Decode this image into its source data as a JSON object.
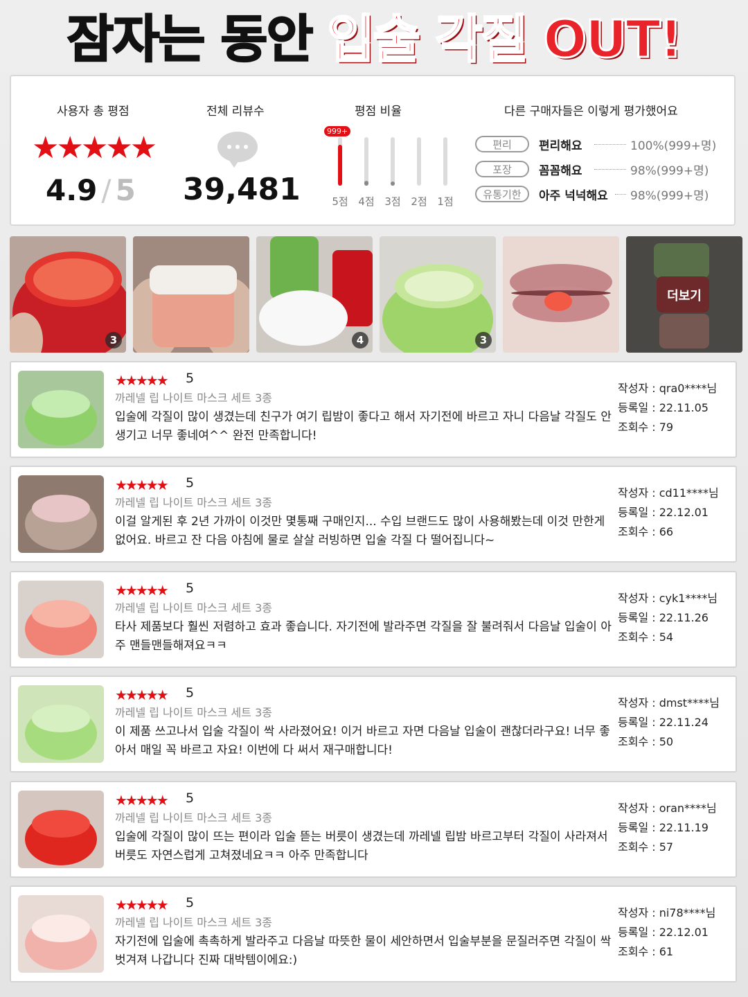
{
  "headline": {
    "part1": "잠자는 동안",
    "part2": "입술 각질 OUT!"
  },
  "summary": {
    "rating_title": "사용자 총 평점",
    "stars": "★★★★★",
    "rating": "4.9",
    "slash": "/",
    "rating_max": "5",
    "count_title": "전체 리뷰수",
    "review_count": "39,481",
    "ratio_title": "평점 비율",
    "ratio_badge": "999+",
    "ratio_bars": [
      {
        "label": "5점",
        "fill": 0.85,
        "color": "#e20f14"
      },
      {
        "label": "4점",
        "fill": 0.1,
        "color": "#888888"
      },
      {
        "label": "3점",
        "fill": 0.08,
        "color": "#888888"
      },
      {
        "label": "2점",
        "fill": 0.0,
        "color": "#888888"
      },
      {
        "label": "1점",
        "fill": 0.0,
        "color": "#888888"
      }
    ],
    "eval_title": "다른 구매자들은 이렇게 평가했어요",
    "evals": [
      {
        "pill": "편리",
        "text": "편리해요",
        "pct": "100%(999+명)"
      },
      {
        "pill": "포장",
        "text": "꼼꼼해요",
        "pct": "98%(999+명)"
      },
      {
        "pill": "유통기한",
        "text": "아주 넉넉해요",
        "pct": "98%(999+명)"
      }
    ]
  },
  "photos": {
    "counts": [
      "3",
      "4",
      "3"
    ],
    "more_label": "더보기"
  },
  "reviews": [
    {
      "stars": "★★★★★",
      "score": "5",
      "product": "까레넬 립 나이트 마스크 세트 3종",
      "text": "입술에 각질이 많이 생겼는데 친구가 여기 립밤이 좋다고 해서 자기전에 바르고 자니 다음날 각질도 안생기고 너무 좋네여^^ 완전 만족합니다!",
      "author": "작성자 : qra0****님",
      "date": "등록일 : 22.11.05",
      "views": "조회수 : 79"
    },
    {
      "stars": "★★★★★",
      "score": "5",
      "product": "까레넬 립 나이트 마스크 세트 3종",
      "text": "이걸 알게된 후 2년 가까이 이것만 몇통째 구매인지... 수입 브랜드도 많이 사용해봤는데 이것 만한게 없어요. 바르고 잔 다음 아침에 물로 살살 러빙하면 입술 각질 다 떨어집니다~",
      "author": "작성자 : cd11****님",
      "date": "등록일 : 22.12.01",
      "views": "조회수 : 66"
    },
    {
      "stars": "★★★★★",
      "score": "5",
      "product": "까레넬 립 나이트 마스크 세트 3종",
      "text": "타사 제품보다 훨씬 저렴하고 효과 좋습니다. 자기전에 발라주면 각질을 잘 불려줘서 다음날 입술이 아주 맨들맨들해져요ㅋㅋ",
      "author": "작성자 : cyk1****님",
      "date": "등록일 : 22.11.26",
      "views": "조회수 : 54"
    },
    {
      "stars": "★★★★★",
      "score": "5",
      "product": "까레넬 립 나이트 마스크 세트 3종",
      "text": "이 제품 쓰고나서 입술 각질이 싹 사라졌어요! 이거 바르고 자면 다음날 입술이 괜찮더라구요! 너무 좋아서 매일 꼭 바르고 자요! 이번에 다 써서 재구매합니다!",
      "author": "작성자 : dmst****님",
      "date": "등록일 : 22.11.24",
      "views": "조회수 : 50"
    },
    {
      "stars": "★★★★★",
      "score": "5",
      "product": "까레넬 립 나이트 마스크 세트 3종",
      "text": "입술에 각질이 많이 뜨는 편이라 입술 뜯는 버릇이 생겼는데 까레넬 립밤 바르고부터 각질이 사라져서 버릇도 자연스럽게 고쳐졌네요ㅋㅋ 아주 만족합니다",
      "author": "작성자 : oran****님",
      "date": "등록일 : 22.11.19",
      "views": "조회수 : 57"
    },
    {
      "stars": "★★★★★",
      "score": "5",
      "product": "까레넬 립 나이트 마스크 세트 3종",
      "text": "자기전에 입술에 촉촉하게 발라주고 다음날 따뜻한 물이 세안하면서 입술부분을 문질러주면 각질이 싹 벗겨져 나갑니다 진짜 대박템이에요:)",
      "author": "작성자 : ni78****님",
      "date": "등록일 : 22.12.01",
      "views": "조회수 : 61"
    }
  ]
}
